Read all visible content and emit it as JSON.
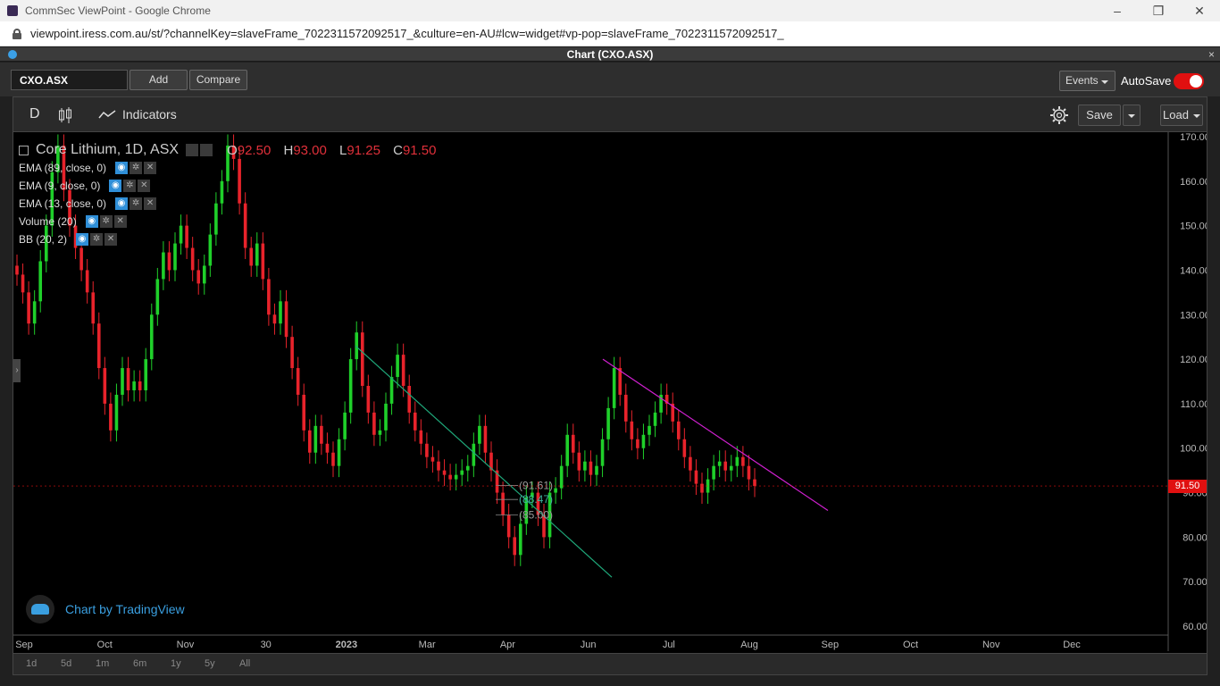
{
  "browser": {
    "window_title": "CommSec ViewPoint - Google Chrome",
    "url": "viewpoint.iress.com.au/st/?channelKey=slaveFrame_7022311572092517_&culture=en-AU#lcw=widget#vp-pop=slaveFrame_7022311572092517_",
    "controls": [
      "–",
      "❐",
      "✕"
    ]
  },
  "panel": {
    "title": "Chart (CXO.ASX)",
    "close": "×"
  },
  "toolbar": {
    "symbol": "CXO.ASX",
    "add_label": "Add",
    "compare_label": "Compare",
    "events_label": "Events",
    "autosave_label": "AutoSave",
    "autosave_on": true
  },
  "chart_toolbar": {
    "interval": "D",
    "indicators_label": "Indicators",
    "save_label": "Save",
    "load_label": "Load"
  },
  "legend": {
    "title": "Core Lithium, 1D, ASX",
    "open_label": "O",
    "open": "92.50",
    "high_label": "H",
    "high": "93.00",
    "low_label": "L",
    "low": "91.25",
    "close_label": "C",
    "close": "91.50"
  },
  "indicators": [
    {
      "label": "EMA (89, close, 0)"
    },
    {
      "label": "EMA (9, close, 0)"
    },
    {
      "label": "EMA (13, close, 0)"
    },
    {
      "label": "Volume (20)"
    },
    {
      "label": "BB (20, 2)"
    }
  ],
  "branding": {
    "text": "Chart by TradingView"
  },
  "range_buttons": [
    "1d",
    "5d",
    "1m",
    "6m",
    "1y",
    "5y",
    "All"
  ],
  "chart_data": {
    "type": "candlestick",
    "symbol": "CXO.ASX",
    "y_axis_ticks": [
      "170.00",
      "160.00",
      "150.00",
      "140.00",
      "130.00",
      "120.00",
      "110.00",
      "100.00",
      "90.00",
      "80.00",
      "70.00",
      "60.00"
    ],
    "ylim": [
      58,
      171
    ],
    "x_axis_ticks": [
      "Sep",
      "Oct",
      "Nov",
      "30",
      "2023",
      "Mar",
      "Apr",
      "Jun",
      "Jul",
      "Aug",
      "Sep",
      "Oct",
      "Nov",
      "Dec"
    ],
    "last_price_label": "91.50",
    "fib_labels": [
      "(91.61)",
      "(88.47)",
      "(85.00)"
    ],
    "closes": [
      139,
      135,
      128,
      133,
      142,
      150,
      162,
      168,
      158,
      150,
      145,
      140,
      135,
      128,
      118,
      110,
      104,
      112,
      118,
      113,
      115,
      113,
      120,
      130,
      138,
      144,
      140,
      146,
      150,
      145,
      140,
      137,
      141,
      148,
      155,
      160,
      168,
      165,
      155,
      145,
      141,
      146,
      138,
      130,
      128,
      133,
      125,
      118,
      112,
      104,
      99,
      105,
      101,
      99,
      96,
      102,
      108,
      120,
      126,
      114,
      108,
      103,
      104,
      110,
      116,
      121,
      114,
      108,
      104,
      101,
      98,
      97,
      95,
      94,
      93,
      94,
      95,
      96,
      101,
      105,
      99,
      95,
      90,
      85,
      80,
      76,
      83,
      89,
      90,
      85,
      80,
      90,
      91,
      96,
      103,
      99,
      95,
      97,
      94,
      96,
      102,
      109,
      118,
      112,
      106,
      102,
      100,
      103,
      105,
      108,
      112,
      110,
      106,
      102,
      98,
      95,
      92,
      90,
      93,
      96,
      97,
      95,
      96,
      98,
      96,
      93,
      91.5
    ],
    "trendlines": [
      {
        "name": "green",
        "color": "#1fa87a",
        "from": [
          "Jan",
          123
        ],
        "to": [
          "May",
          71
        ]
      },
      {
        "name": "magenta",
        "color": "#d020d0",
        "from": [
          "May",
          120
        ],
        "to": [
          "Aug",
          86
        ]
      }
    ],
    "up_color": "#1fd02a",
    "down_color": "#e8232b"
  }
}
